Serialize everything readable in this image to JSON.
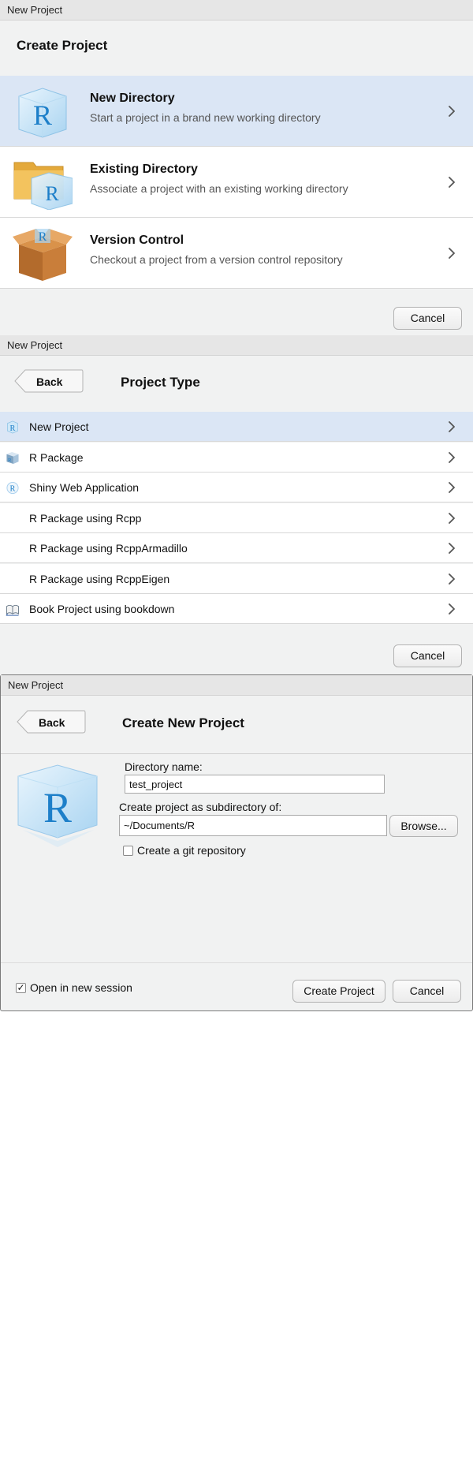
{
  "panel1": {
    "window_title": "New Project",
    "heading": "Create Project",
    "options": [
      {
        "title": "New Directory",
        "subtitle": "Start a project in a brand new working directory",
        "icon": "r-cube-icon"
      },
      {
        "title": "Existing Directory",
        "subtitle": "Associate a project with an existing working directory",
        "icon": "folder-r-icon"
      },
      {
        "title": "Version Control",
        "subtitle": "Checkout a project from a version control repository",
        "icon": "box-icon"
      }
    ],
    "cancel_label": "Cancel"
  },
  "panel2": {
    "window_title": "New Project",
    "back_label": "Back",
    "heading": "Project Type",
    "items": [
      {
        "label": "New Project",
        "icon": "r-cube-small-icon"
      },
      {
        "label": "R Package",
        "icon": "package-icon"
      },
      {
        "label": "Shiny Web Application",
        "icon": "shiny-icon"
      },
      {
        "label": "R Package using Rcpp",
        "icon": ""
      },
      {
        "label": "R Package using RcppArmadillo",
        "icon": ""
      },
      {
        "label": "R Package using RcppEigen",
        "icon": ""
      },
      {
        "label": "Book Project using bookdown",
        "icon": "book-icon"
      }
    ],
    "cancel_label": "Cancel"
  },
  "panel3": {
    "window_title": "New Project",
    "back_label": "Back",
    "heading": "Create New Project",
    "directory_name_label": "Directory name:",
    "directory_name_value": "test_project",
    "subdirectory_label": "Create project as subdirectory of:",
    "subdirectory_value": "~/Documents/R",
    "browse_label": "Browse...",
    "git_label": "Create a git repository",
    "git_checked": false,
    "open_session_label": "Open in new session",
    "open_session_checked": true,
    "create_label": "Create Project",
    "cancel_label": "Cancel"
  },
  "colors": {
    "selected_row": "#dbe6f5",
    "panel_bg": "#f1f2f2",
    "accent_blue": "#2b8fd6"
  }
}
